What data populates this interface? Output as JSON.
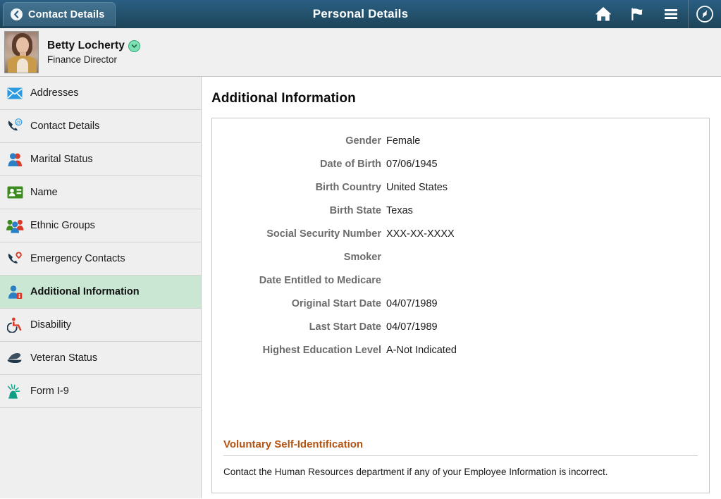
{
  "header": {
    "back_label": "Contact Details",
    "title": "Personal Details",
    "icons": [
      {
        "name": "home-icon",
        "label": "Home"
      },
      {
        "name": "flag-icon",
        "label": "Notifications"
      },
      {
        "name": "hamburger-menu-icon",
        "label": "Actions Menu"
      },
      {
        "name": "navigator-compass-icon",
        "label": "NavBar"
      }
    ],
    "accent_color": "#24536f"
  },
  "person": {
    "name": "Betty Locherty",
    "job_title": "Finance Director",
    "badge_icon": "chevron-down-icon",
    "badge_color": "#7fe0b4"
  },
  "sidebar": {
    "items": [
      {
        "label": "Addresses",
        "icon": "envelope-icon",
        "selected": false
      },
      {
        "label": "Contact Details",
        "icon": "phone-at-icon",
        "selected": false
      },
      {
        "label": "Marital Status",
        "icon": "two-persons-icon",
        "selected": false
      },
      {
        "label": "Name",
        "icon": "id-card-icon",
        "selected": false
      },
      {
        "label": "Ethnic Groups",
        "icon": "group-people-icon",
        "selected": false
      },
      {
        "label": "Emergency Contacts",
        "icon": "phone-medical-icon",
        "selected": false
      },
      {
        "label": "Additional Information",
        "icon": "person-info-icon",
        "selected": true
      },
      {
        "label": "Disability",
        "icon": "wheelchair-icon",
        "selected": false
      },
      {
        "label": "Veteran Status",
        "icon": "military-cap-icon",
        "selected": false
      },
      {
        "label": "Form I-9",
        "icon": "statue-of-liberty-icon",
        "selected": false
      }
    ],
    "selected_color": "#c9e7d2"
  },
  "main": {
    "heading": "Additional Information",
    "fields": [
      {
        "label": "Gender",
        "value": "Female"
      },
      {
        "label": "Date of Birth",
        "value": "07/06/1945"
      },
      {
        "label": "Birth Country",
        "value": "United States"
      },
      {
        "label": "Birth State",
        "value": "Texas"
      },
      {
        "label": "Social Security Number",
        "value": "XXX-XX-XXXX"
      },
      {
        "label": "Smoker",
        "value": ""
      },
      {
        "label": "Date Entitled to Medicare",
        "value": ""
      },
      {
        "label": "Original Start Date",
        "value": "04/07/1989"
      },
      {
        "label": "Last Start Date",
        "value": "04/07/1989"
      },
      {
        "label": "Highest Education Level",
        "value": "A-Not Indicated"
      }
    ],
    "self_identification": {
      "link_label": "Voluntary Self-Identification",
      "link_color": "#b35311",
      "note": "Contact the Human Resources department if any of your Employee Information is incorrect."
    }
  }
}
